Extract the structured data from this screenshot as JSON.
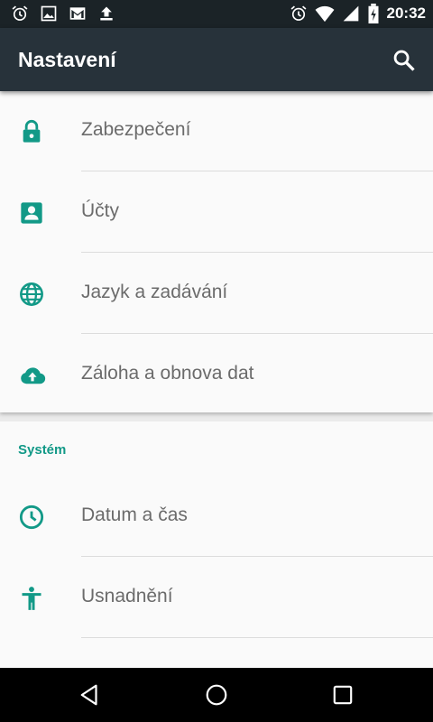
{
  "status_bar": {
    "time": "20:32",
    "left_icons": [
      "alarm-icon",
      "image-icon",
      "gmail-icon",
      "upload-icon"
    ],
    "right_icons": [
      "alarm-icon",
      "wifi-icon",
      "signal-icon",
      "battery-charging-icon"
    ]
  },
  "toolbar": {
    "title": "Nastavení",
    "search_icon": "search-icon"
  },
  "settings": {
    "personal_items": [
      {
        "label": "Zabezpečení",
        "icon": "lock-icon"
      },
      {
        "label": "Účty",
        "icon": "account-icon"
      },
      {
        "label": "Jazyk a zadávání",
        "icon": "globe-icon"
      },
      {
        "label": "Záloha a obnova dat",
        "icon": "cloud-upload-icon"
      }
    ],
    "system_header": "Systém",
    "system_items": [
      {
        "label": "Datum a čas",
        "icon": "clock-icon"
      },
      {
        "label": "Usnadnění",
        "icon": "accessibility-icon"
      }
    ]
  },
  "nav_bar": {
    "buttons": [
      "back-icon",
      "home-icon",
      "recents-icon"
    ]
  },
  "colors": {
    "accent": "#129987",
    "toolbar": "#27323a",
    "status_bar": "#1b2327",
    "label_text": "#6b6b6b"
  }
}
